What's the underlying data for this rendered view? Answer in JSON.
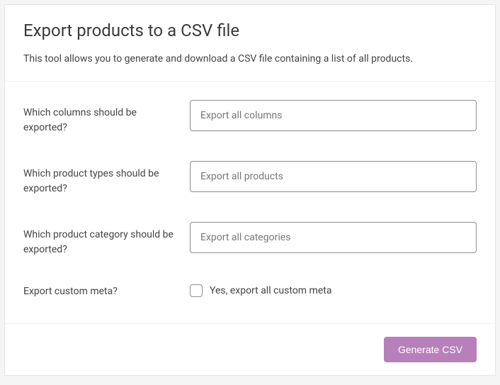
{
  "header": {
    "title": "Export products to a CSV file",
    "description": "This tool allows you to generate and download a CSV file containing a list of all products."
  },
  "form": {
    "columns": {
      "label": "Which columns should be exported?",
      "placeholder": "Export all columns"
    },
    "types": {
      "label": "Which product types should be exported?",
      "placeholder": "Export all products"
    },
    "category": {
      "label": "Which product category should be exported?",
      "placeholder": "Export all categories"
    },
    "meta": {
      "label": "Export custom meta?",
      "checkbox_label": "Yes, export all custom meta"
    }
  },
  "footer": {
    "submit_label": "Generate CSV"
  }
}
